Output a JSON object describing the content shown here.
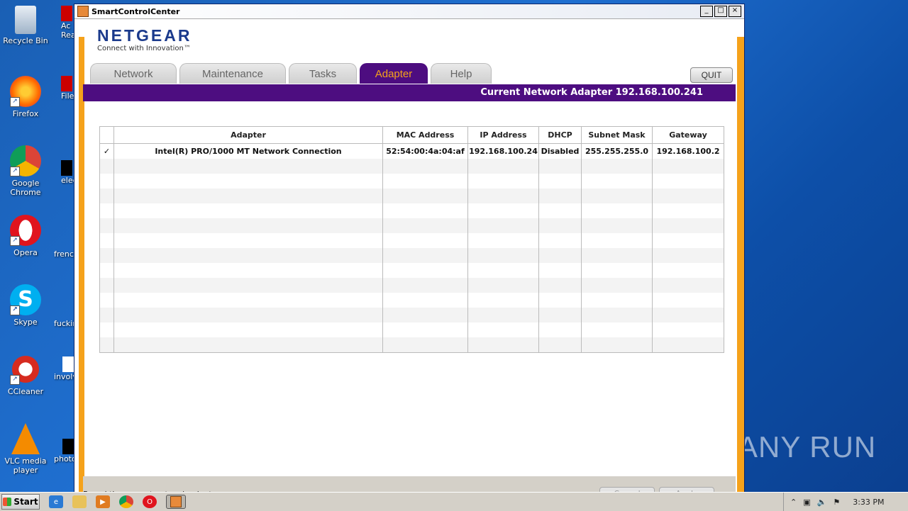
{
  "desktop": {
    "icons": [
      {
        "label": "Recycle Bin"
      },
      {
        "label": "Firefox"
      },
      {
        "label": "Google Chrome"
      },
      {
        "label": "Opera"
      },
      {
        "label": "Skype"
      },
      {
        "label": "CCleaner"
      },
      {
        "label": "VLC media player"
      }
    ],
    "partial_labels": [
      "Ac Rea",
      "FileZi",
      "electr",
      "frencl",
      "fuckin",
      "involv",
      "photo"
    ]
  },
  "window": {
    "title": "SmartControlCenter",
    "controls": {
      "minimize": "_",
      "maximize": "□",
      "close": "×"
    }
  },
  "logo": {
    "brand": "NETGEAR",
    "tagline": "Connect with Innovation™"
  },
  "tabs": [
    {
      "label": "Network",
      "active": false
    },
    {
      "label": "Maintenance",
      "active": false
    },
    {
      "label": "Tasks",
      "active": false
    },
    {
      "label": "Adapter",
      "active": true
    },
    {
      "label": "Help",
      "active": false
    }
  ],
  "quit_label": "QUIT",
  "current_adapter_text": "Current Network Adapter 192.168.100.241",
  "table": {
    "headers": [
      "",
      "Adapter",
      "MAC Address",
      "IP Address",
      "DHCP",
      "Subnet Mask",
      "Gateway"
    ],
    "rows": [
      [
        "✓",
        "Intel(R) PRO/1000 MT Network Connection",
        "52:54:00:4a:04:af",
        "192.168.100.24",
        "Disabled",
        "255.255.255.0",
        "192.168.100.2"
      ]
    ],
    "empty_rows": 13
  },
  "status": {
    "text": "Found the current network adapter",
    "cancel_label": "Cancel",
    "apply_label": "Apply"
  },
  "taskbar": {
    "start_label": "Start",
    "clock": "3:33 PM"
  },
  "watermark": "ANY RUN",
  "colors": {
    "accent_purple": "#4d0d80",
    "accent_orange": "#f5a21b",
    "brand_blue": "#1b3a8c"
  }
}
